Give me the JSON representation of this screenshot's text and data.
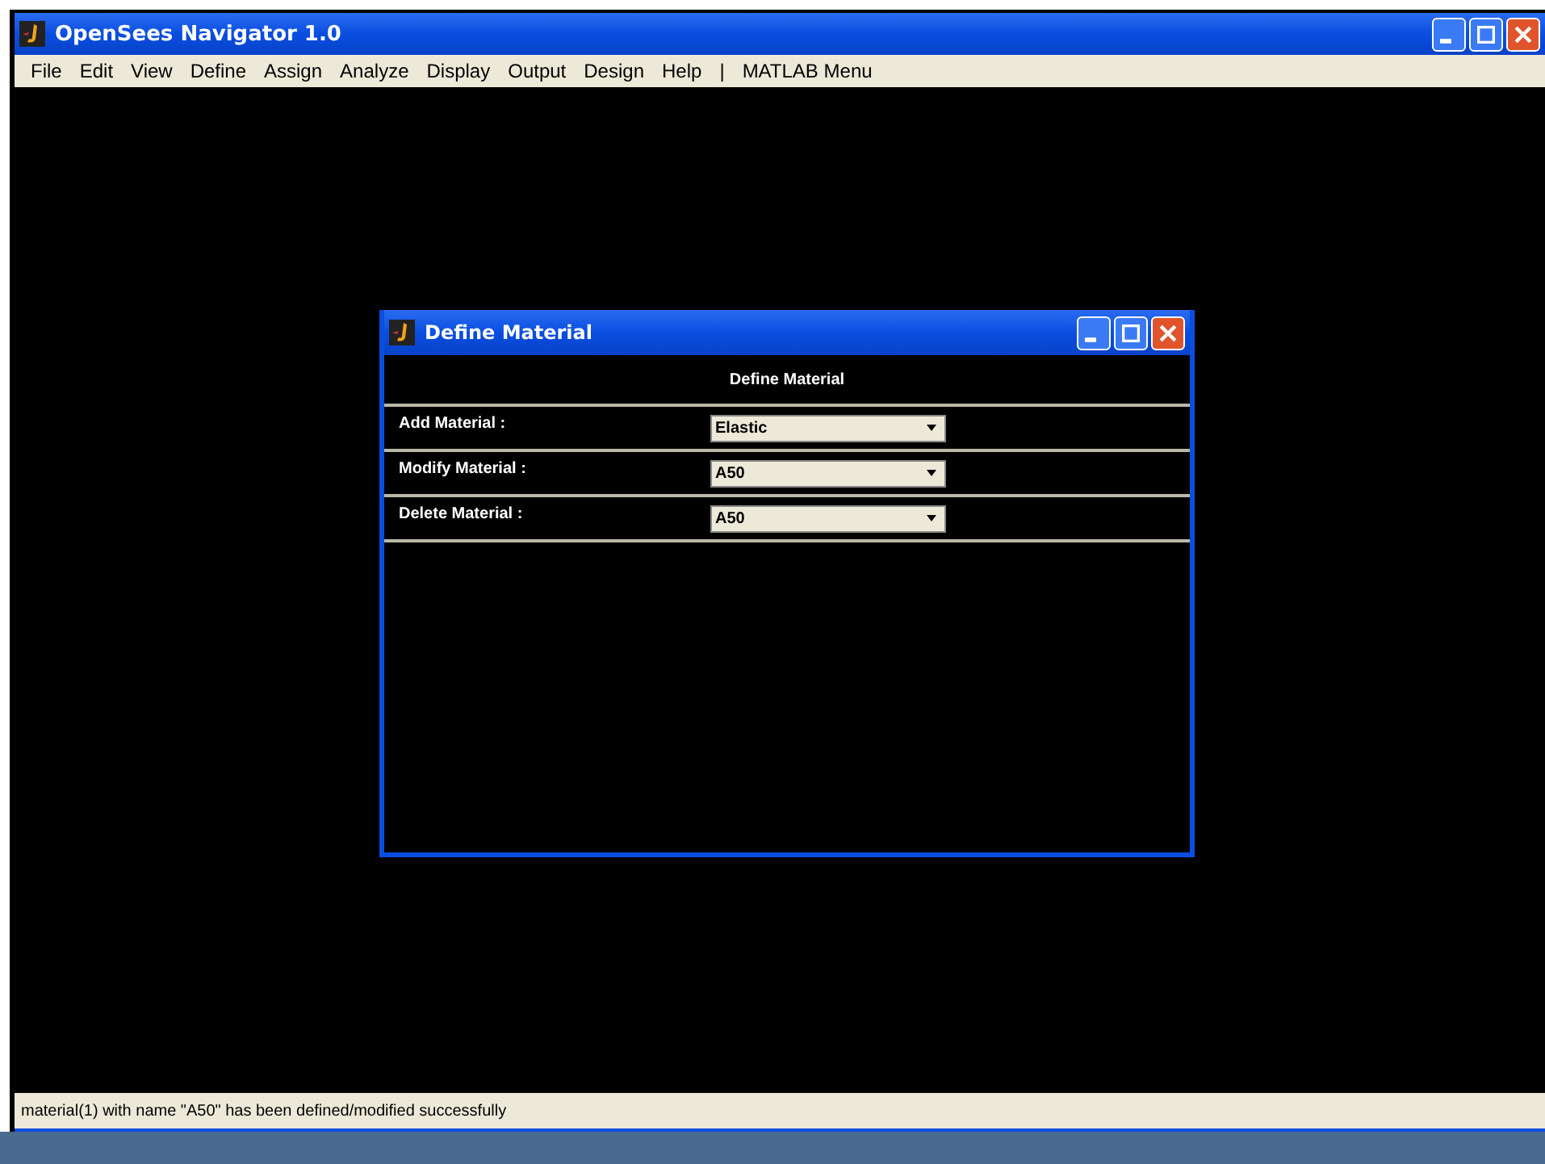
{
  "window": {
    "title": "OpenSees Navigator 1.0"
  },
  "menu": [
    "File",
    "Edit",
    "View",
    "Define",
    "Assign",
    "Analyze",
    "Display",
    "Output",
    "Design",
    "Help",
    "|",
    "MATLAB Menu"
  ],
  "dialog": {
    "title": "Define Material",
    "heading": "Define Material",
    "rows": [
      {
        "label": "Add Material :",
        "value": "Elastic"
      },
      {
        "label": "Modify Material :",
        "value": "A50"
      },
      {
        "label": "Delete Material :",
        "value": "A50"
      }
    ]
  },
  "status_bar": "material(1) with name \"A50\" has been defined/modified successfully"
}
